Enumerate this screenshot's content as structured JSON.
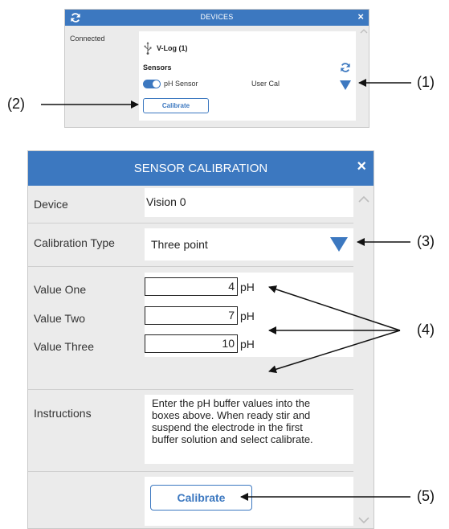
{
  "devices_panel": {
    "title": "DEVICES",
    "close": "×",
    "connected_label": "Connected",
    "device_name": "V-Log (1)",
    "sensors_heading": "Sensors",
    "sensor_name": "pH Sensor",
    "sensor_mode": "User Cal",
    "calibrate_button": "Calibrate",
    "sensor_enabled": true
  },
  "calibration_dialog": {
    "title": "SENSOR CALIBRATION",
    "close": "×",
    "device": {
      "label": "Device",
      "value": "Vision 0"
    },
    "calibration_type": {
      "label": "Calibration Type",
      "value": "Three point"
    },
    "values": [
      {
        "label": "Value One",
        "value": "4",
        "unit": "pH"
      },
      {
        "label": "Value Two",
        "value": "7",
        "unit": "pH"
      },
      {
        "label": "Value Three",
        "value": "10",
        "unit": "pH"
      }
    ],
    "instructions": {
      "label": "Instructions",
      "lines": [
        "Enter the pH buffer values into the",
        "boxes above. When ready stir and",
        "suspend the electrode in the first",
        "buffer solution and select calibrate."
      ]
    },
    "calibrate_button": "Calibrate"
  },
  "callouts": [
    "(1)",
    "(2)",
    "(3)",
    "(4)",
    "(5)"
  ],
  "colors": {
    "accent": "#3c78c0",
    "panel_bg": "#ebebeb",
    "divider": "#cfcfcf"
  },
  "icons": [
    "refresh-icon",
    "close-icon",
    "usb-icon",
    "dropdown-triangle-icon",
    "chevron-up-icon",
    "chevron-down-icon"
  ]
}
